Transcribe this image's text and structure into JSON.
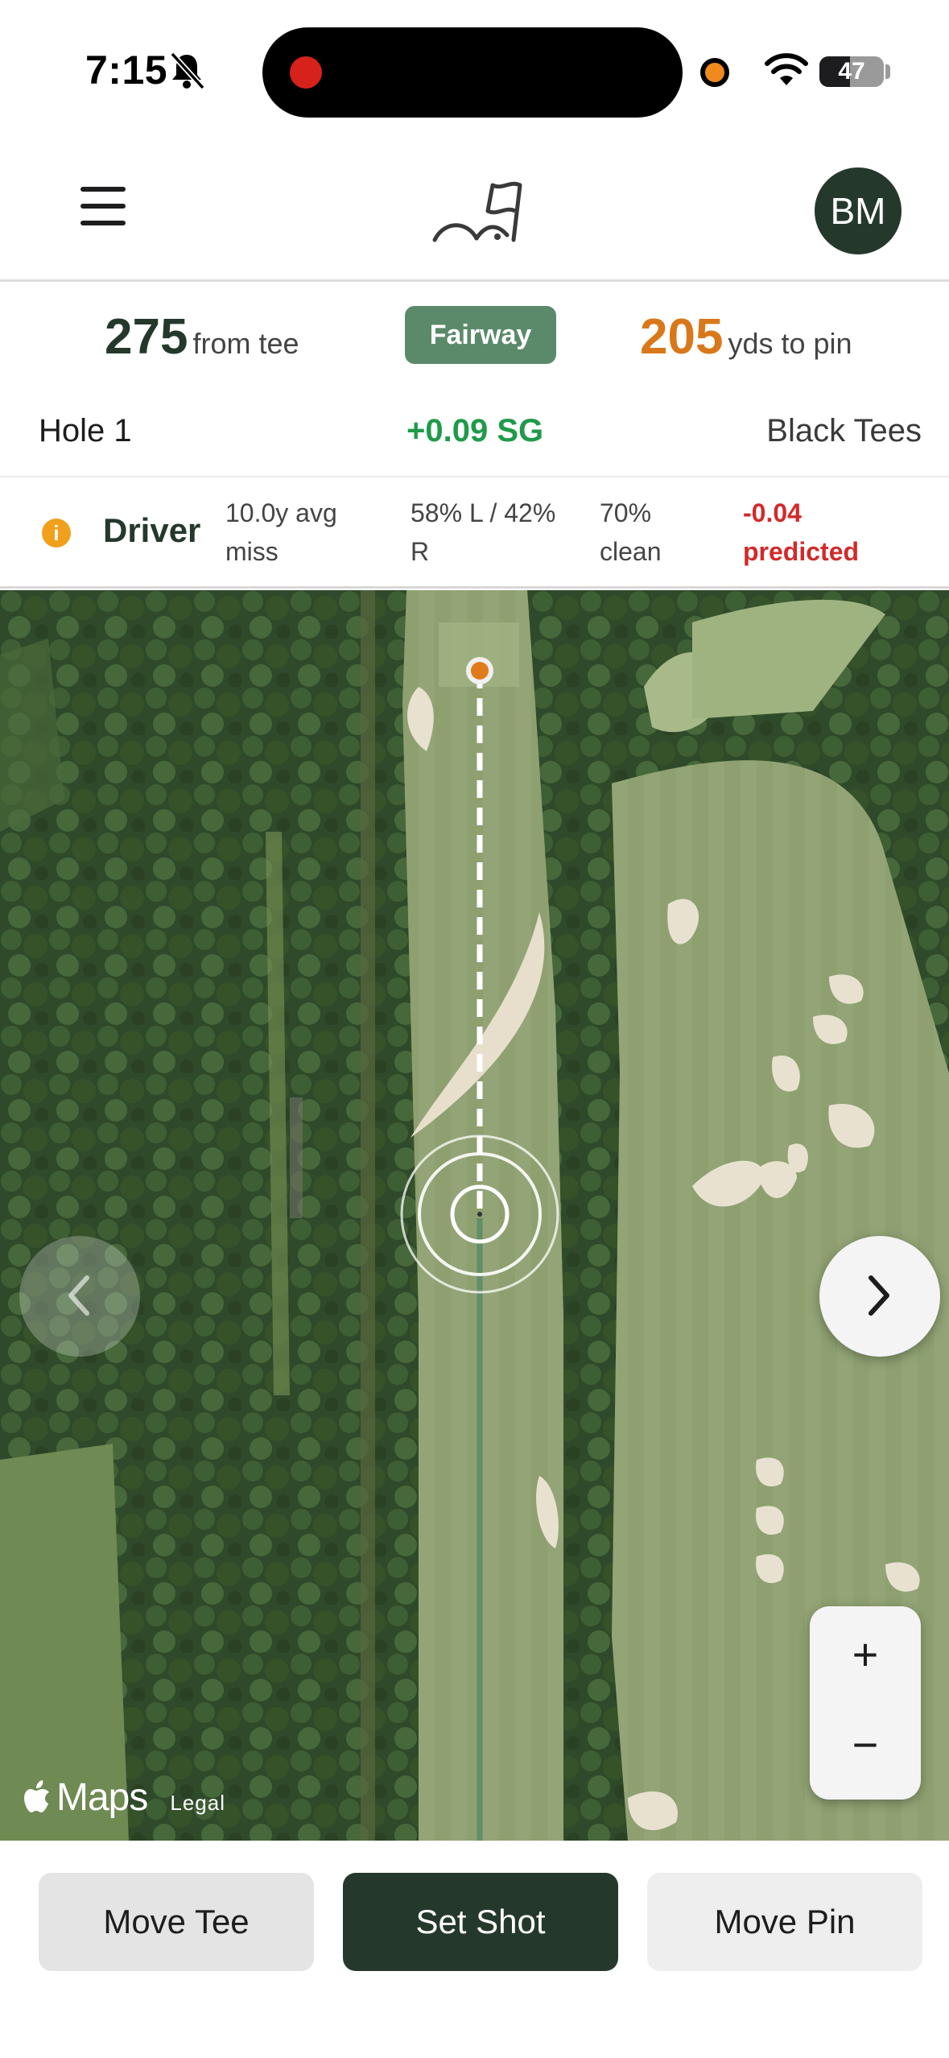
{
  "status_bar": {
    "time": "7:15",
    "battery_text": "47",
    "battery_level": 0.47,
    "icons": [
      "bell-slash-icon",
      "recording-dot-icon",
      "camera-in-use-dot-icon",
      "wifi-icon",
      "battery-icon"
    ]
  },
  "header": {
    "menu_icon": "hamburger-menu-icon",
    "logo_icon": "golf-flag-logo-icon",
    "avatar_initials": "BM"
  },
  "distance": {
    "from_tee_value": "275",
    "from_tee_label": "from tee",
    "lie": "Fairway",
    "to_pin_value": "205",
    "to_pin_label": "yds to pin"
  },
  "hole": {
    "label": "Hole 1",
    "strokes_gained": "+0.09 SG",
    "tees": "Black Tees"
  },
  "club": {
    "info_icon": "i",
    "name": "Driver",
    "avg_miss": "10.0y avg miss",
    "left_right": "58% L / 42% R",
    "clean": "70% clean",
    "predicted": "-0.04 predicted"
  },
  "map": {
    "zoom_in": "+",
    "zoom_out": "−",
    "maps_logo": "Maps",
    "legal": "Legal",
    "prev_icon": "chevron-left-icon",
    "next_icon": "chevron-right-icon"
  },
  "actions": {
    "move_tee": "Move Tee",
    "set_shot": "Set Shot",
    "move_pin": "Move Pin"
  },
  "colors": {
    "brand_dark": "#24392c",
    "fairway_badge": "#5b8a6a",
    "pin_orange": "#d9781a",
    "sg_green": "#1f9a4a",
    "predicted_red": "#d22a2a",
    "info_orange": "#f0a01c"
  }
}
